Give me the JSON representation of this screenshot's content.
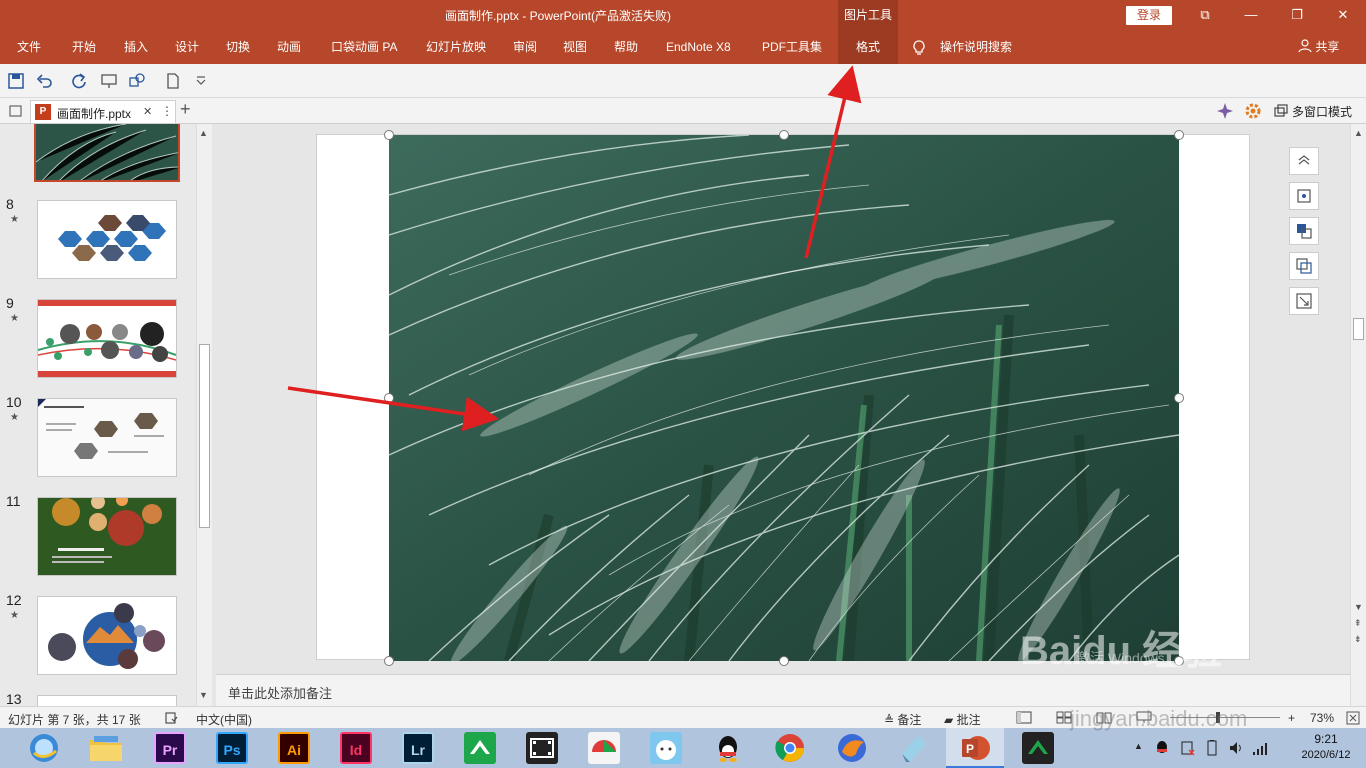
{
  "titlebar": {
    "title": "画面制作.pptx  -  PowerPoint(产品激活失败)",
    "context_group": "图片工具",
    "login": "登录",
    "ribbon_display": "⧉",
    "minimize": "—",
    "restore": "❐",
    "close": "✕"
  },
  "ribbon": {
    "tabs": [
      "文件",
      "开始",
      "插入",
      "设计",
      "切换",
      "动画",
      "口袋动画 PA",
      "幻灯片放映",
      "审阅",
      "视图",
      "帮助",
      "EndNote X8",
      "PDF工具集",
      "格式"
    ],
    "search": "操作说明搜索",
    "share": "共享",
    "active_tab": "格式"
  },
  "doc_tabs": {
    "file_name": "画面制作.pptx",
    "close": "✕",
    "more": "⋮",
    "new": "+",
    "multi_window": "多窗口模式"
  },
  "thumbnails": [
    {
      "num": "8",
      "star": "★",
      "color": "#2f73b9"
    },
    {
      "num": "9",
      "star": "★",
      "color": "#d9443a"
    },
    {
      "num": "10",
      "star": "★",
      "color": "#666666"
    },
    {
      "num": "11",
      "star": "",
      "color": "#2e5a22"
    },
    {
      "num": "12",
      "star": "★",
      "color": "#2a5da3"
    },
    {
      "num": "13",
      "star": "",
      "color": "#ffffff"
    }
  ],
  "notes": {
    "placeholder": "单击此处添加备注"
  },
  "status": {
    "slide_info": "幻灯片 第 7 张，共 17 张",
    "language": "中文(中国)",
    "notes": "备注",
    "comments": "批注",
    "zoom": "73%",
    "zoom_plus": "+"
  },
  "taskbar": {
    "apps": [
      {
        "name": "Pr",
        "color": "#2a0a4a",
        "fg": "#e8a3ff"
      },
      {
        "name": "Ps",
        "color": "#001e36",
        "fg": "#31a8ff"
      },
      {
        "name": "Ai",
        "color": "#330000",
        "fg": "#ff9a00"
      },
      {
        "name": "Id",
        "color": "#49021f",
        "fg": "#ff3366"
      },
      {
        "name": "Lr",
        "color": "#001e36",
        "fg": "#add5ec"
      }
    ],
    "time": "9:21",
    "date": "2020/6/12"
  },
  "watermark": {
    "main": "Baidu 经验",
    "sub": "jingyan.baidu.com",
    "activate": "激活 Windows"
  },
  "colors": {
    "accent": "#b7472a",
    "accent_dark": "#9c3b22",
    "arrow": "#e02020"
  }
}
